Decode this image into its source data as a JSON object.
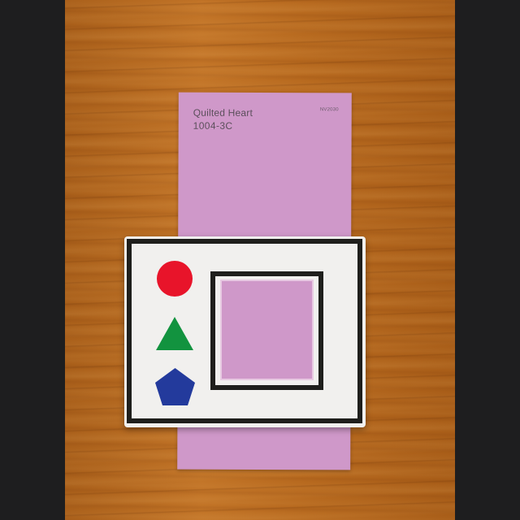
{
  "photo": {
    "paint_chip": {
      "name": "Quilted Heart",
      "code": "1004-3C",
      "id_label": "NV2030",
      "color": "#cf98c9"
    },
    "card": {
      "background": "#f1f0ee",
      "frame_color": "#1f1f1c",
      "shapes": [
        {
          "shape": "circle",
          "color": "#e8142a"
        },
        {
          "shape": "triangle",
          "color": "#12933f"
        },
        {
          "shape": "pentagon",
          "color": "#233a9c"
        }
      ]
    },
    "surface": "wood"
  }
}
